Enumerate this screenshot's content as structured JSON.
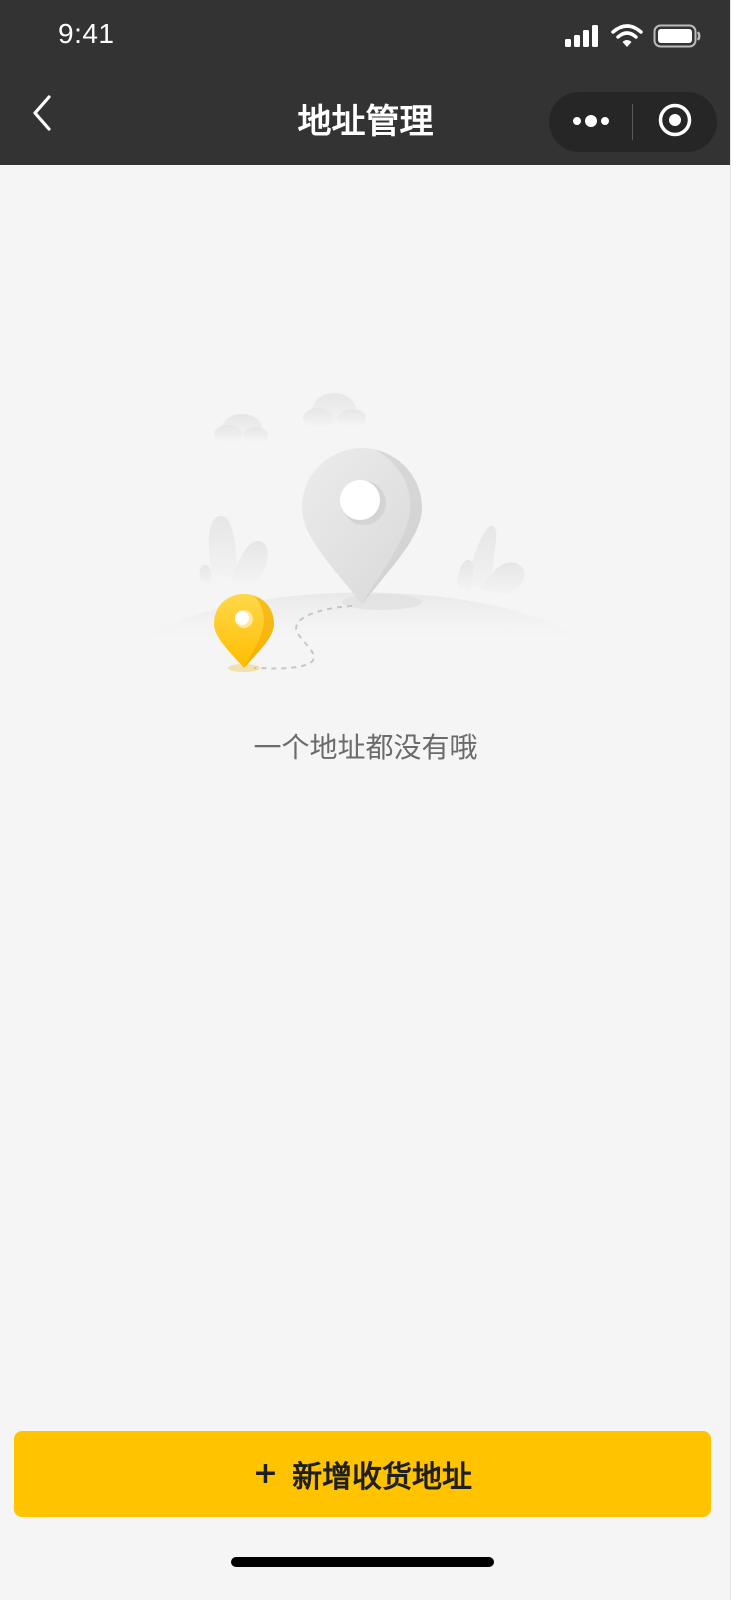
{
  "status_bar": {
    "time": "9:41"
  },
  "nav": {
    "title": "地址管理"
  },
  "empty_state": {
    "message": "一个地址都没有哦"
  },
  "actions": {
    "add_plus": "+",
    "add_label": "新增收货地址"
  },
  "icons": {
    "back": "chevron-left-icon",
    "more": "more-dots-icon",
    "close": "target-circle-icon",
    "signal": "signal-bars-icon",
    "wifi": "wifi-icon",
    "battery": "battery-icon"
  },
  "colors": {
    "nav_background": "#333333",
    "page_background": "#f5f5f5",
    "accent": "#ffc300",
    "empty_text": "#6b6b6b"
  }
}
